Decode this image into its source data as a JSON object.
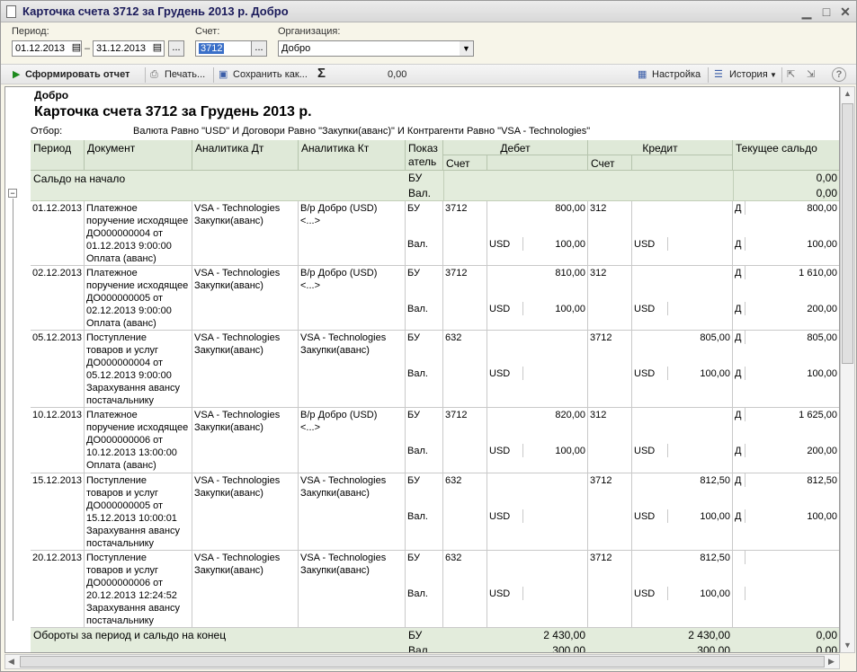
{
  "window": {
    "title": "Карточка счета 3712 за Грудень 2013 р. Добро"
  },
  "filters": {
    "period_label": "Период:",
    "date_from": "01.12.2013",
    "date_sep": "–",
    "date_to": "31.12.2013",
    "dots": "...",
    "account_label": "Счет:",
    "account_value": "3712",
    "org_label": "Организация:",
    "org_value": "Добро"
  },
  "toolbar": {
    "generate": "Сформировать отчет",
    "print": "Печать...",
    "save": "Сохранить как...",
    "sum_value": "0,00",
    "settings": "Настройка",
    "history": "История"
  },
  "report": {
    "org": "Добро",
    "title": "Карточка счета 3712 за Грудень 2013 р.",
    "filter_label": "Отбор:",
    "filter_value": "Валюта Равно \"USD\" И Договори Равно \"Закупки(аванс)\" И Контрагенти Равно \"VSA - Technologies\"",
    "headers": {
      "period": "Период",
      "document": "Документ",
      "an_dt": "Аналитика Дт",
      "an_kt": "Аналитика Кт",
      "pok1": "Показ",
      "pok2": "атель",
      "debit": "Дебет",
      "credit": "Кредит",
      "balance": "Текущее сальдо",
      "acc_d": "Счет",
      "acc_k": "Счет"
    },
    "opening": {
      "label": "Сальдо на начало",
      "bu": "БУ",
      "val": "Вал.",
      "bu_amount": "0,00",
      "val_amount": "0,00"
    },
    "rows": [
      {
        "date": "01.12.2013",
        "doc": [
          "Платежное",
          "поручение исходящее",
          "ДО000000004 от",
          "01.12.2013 9:00:00",
          "Оплата (аванс)"
        ],
        "dt": [
          "VSA - Technologies",
          "Закупки(аванс)"
        ],
        "kt": [
          "В/р Добро (USD)",
          "<...>"
        ],
        "bu": "БУ",
        "val": "Вал.",
        "acc_d": "3712",
        "deb_bu": "800,00",
        "deb_cur": "USD",
        "deb_val": "100,00",
        "acc_k": "312",
        "cred_bu": "",
        "cred_cur": "USD",
        "cred_val": "",
        "bal_bu_s": "Д",
        "bal_bu": "800,00",
        "bal_val_s": "Д",
        "bal_val": "100,00"
      },
      {
        "date": "02.12.2013",
        "doc": [
          "Платежное",
          "поручение исходящее",
          "ДО000000005 от",
          "02.12.2013 9:00:00",
          "Оплата (аванс)"
        ],
        "dt": [
          "VSA - Technologies",
          "Закупки(аванс)"
        ],
        "kt": [
          "В/р Добро (USD)",
          "<...>"
        ],
        "bu": "БУ",
        "val": "Вал.",
        "acc_d": "3712",
        "deb_bu": "810,00",
        "deb_cur": "USD",
        "deb_val": "100,00",
        "acc_k": "312",
        "cred_bu": "",
        "cred_cur": "USD",
        "cred_val": "",
        "bal_bu_s": "Д",
        "bal_bu": "1 610,00",
        "bal_val_s": "Д",
        "bal_val": "200,00"
      },
      {
        "date": "05.12.2013",
        "doc": [
          "Поступление",
          "товаров и услуг",
          "ДО000000004 от",
          "05.12.2013 9:00:00",
          "Зарахування авансу",
          "постачальнику"
        ],
        "dt": [
          "VSA - Technologies",
          "Закупки(аванс)"
        ],
        "kt": [
          "VSA - Technologies",
          "Закупки(аванс)"
        ],
        "bu": "БУ",
        "val": "Вал.",
        "acc_d": "632",
        "deb_bu": "",
        "deb_cur": "USD",
        "deb_val": "",
        "acc_k": "3712",
        "cred_bu": "805,00",
        "cred_cur": "USD",
        "cred_val": "100,00",
        "bal_bu_s": "Д",
        "bal_bu": "805,00",
        "bal_val_s": "Д",
        "bal_val": "100,00"
      },
      {
        "date": "10.12.2013",
        "doc": [
          "Платежное",
          "поручение исходящее",
          "ДО000000006 от",
          "10.12.2013 13:00:00",
          "Оплата (аванс)"
        ],
        "dt": [
          "VSA - Technologies",
          "Закупки(аванс)"
        ],
        "kt": [
          "В/р Добро (USD)",
          "<...>"
        ],
        "bu": "БУ",
        "val": "Вал.",
        "acc_d": "3712",
        "deb_bu": "820,00",
        "deb_cur": "USD",
        "deb_val": "100,00",
        "acc_k": "312",
        "cred_bu": "",
        "cred_cur": "USD",
        "cred_val": "",
        "bal_bu_s": "Д",
        "bal_bu": "1 625,00",
        "bal_val_s": "Д",
        "bal_val": "200,00"
      },
      {
        "date": "15.12.2013",
        "doc": [
          "Поступление",
          "товаров и услуг",
          "ДО000000005 от",
          "15.12.2013 10:00:01",
          "Зарахування авансу",
          "постачальнику"
        ],
        "dt": [
          "VSA - Technologies",
          "Закупки(аванс)"
        ],
        "kt": [
          "VSA - Technologies",
          "Закупки(аванс)"
        ],
        "bu": "БУ",
        "val": "Вал.",
        "acc_d": "632",
        "deb_bu": "",
        "deb_cur": "USD",
        "deb_val": "",
        "acc_k": "3712",
        "cred_bu": "812,50",
        "cred_cur": "USD",
        "cred_val": "100,00",
        "bal_bu_s": "Д",
        "bal_bu": "812,50",
        "bal_val_s": "Д",
        "bal_val": "100,00"
      },
      {
        "date": "20.12.2013",
        "doc": [
          "Поступление",
          "товаров и услуг",
          "ДО000000006 от",
          "20.12.2013 12:24:52",
          "Зарахування авансу",
          "постачальнику"
        ],
        "dt": [
          "VSA - Technologies",
          "Закупки(аванс)"
        ],
        "kt": [
          "VSA - Technologies",
          "Закупки(аванс)"
        ],
        "bu": "БУ",
        "val": "Вал.",
        "acc_d": "632",
        "deb_bu": "",
        "deb_cur": "USD",
        "deb_val": "",
        "acc_k": "3712",
        "cred_bu": "812,50",
        "cred_cur": "USD",
        "cred_val": "100,00",
        "bal_bu_s": "",
        "bal_bu": "",
        "bal_val_s": "",
        "bal_val": ""
      }
    ],
    "totals": {
      "label": "Обороты за период и сальдо на конец",
      "bu": "БУ",
      "val": "Вал.",
      "deb_bu": "2 430,00",
      "deb_val": "300,00",
      "cred_bu": "2 430,00",
      "cred_val": "300,00",
      "bal_bu": "0,00",
      "bal_val": "0,00"
    }
  }
}
